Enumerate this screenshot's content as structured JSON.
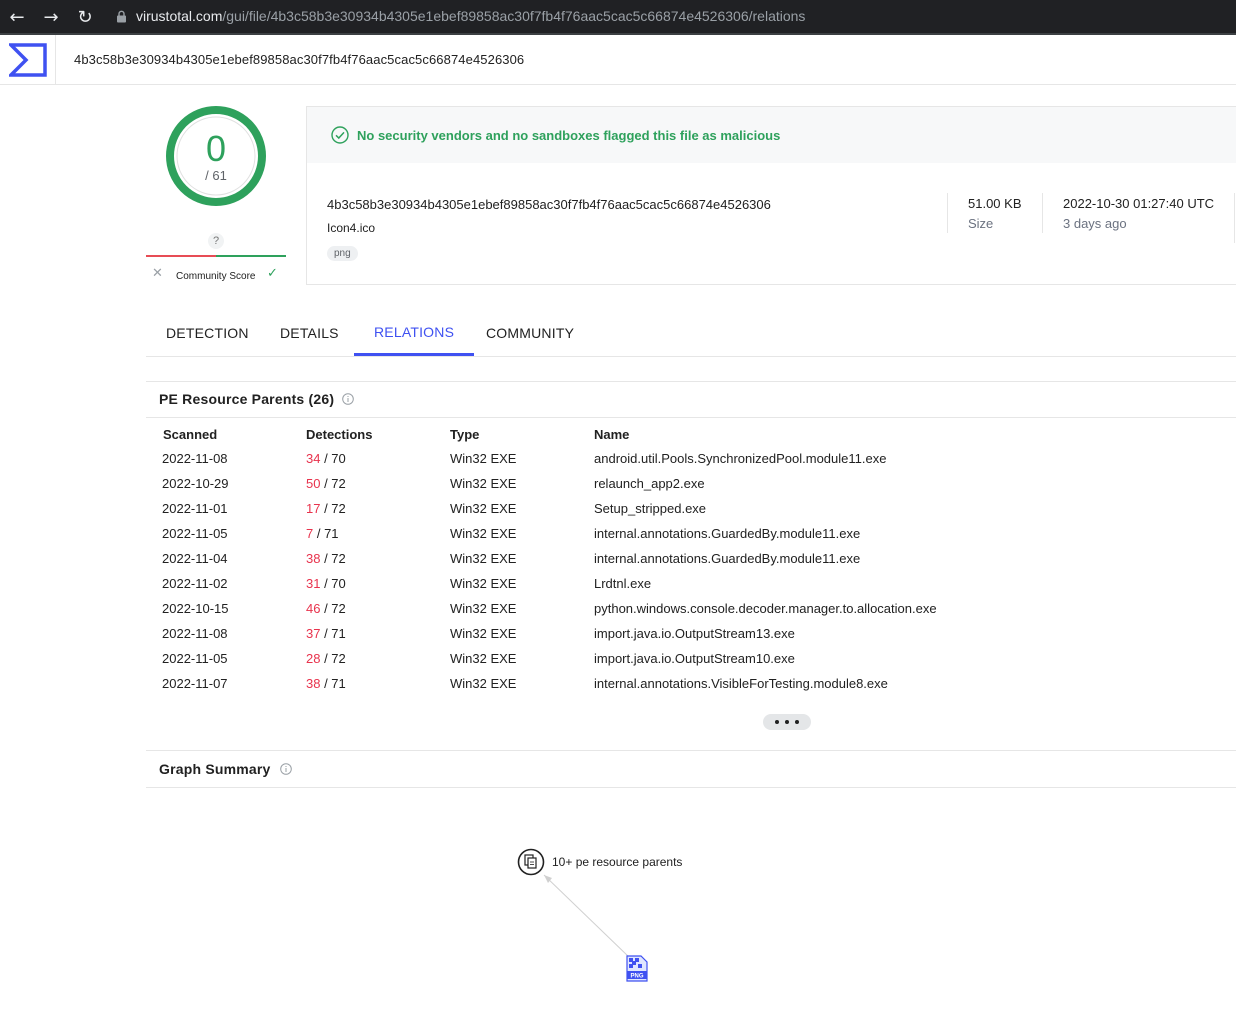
{
  "browser": {
    "url_host": "virustotal.com",
    "url_path": "/gui/file/4b3c58b3e30934b4305e1ebef89858ac30f7fb4f76aac5cac5c66874e4526306/relations",
    "back_icon": "arrow-left-icon",
    "forward_icon": "arrow-right-icon",
    "reload_icon": "reload-icon",
    "lock_icon": "lock-icon"
  },
  "header": {
    "logo": "virustotal-logo",
    "hash": "4b3c58b3e30934b4305e1ebef89858ac30f7fb4f76aac5cac5c66874e4526306"
  },
  "score": {
    "detections": "0",
    "total": "/ 61",
    "community_unknown": "?",
    "community_label": "Community Score",
    "ring_color": "#2ea15c"
  },
  "summary": {
    "banner": "No security vendors and no sandboxes flagged this file as malicious",
    "hash": "4b3c58b3e30934b4305e1ebef89858ac30f7fb4f76aac5cac5c66874e4526306",
    "file_name": "Icon4.ico",
    "tag": "png",
    "size_value": "51.00 KB",
    "size_label": "Size",
    "date_value": "2022-10-30 01:27:40 UTC",
    "date_label": "3 days ago"
  },
  "tabs": [
    {
      "label": "DETECTION",
      "active": false
    },
    {
      "label": "DETAILS",
      "active": false
    },
    {
      "label": "RELATIONS",
      "active": true
    },
    {
      "label": "COMMUNITY",
      "active": false
    }
  ],
  "pe_section": {
    "title": "PE Resource Parents (26)",
    "columns": [
      "Scanned",
      "Detections",
      "Type",
      "Name"
    ],
    "rows": [
      {
        "scanned": "2022-11-08",
        "det": "34",
        "total": " / 70",
        "type": "Win32 EXE",
        "name": "android.util.Pools.SynchronizedPool.module11.exe"
      },
      {
        "scanned": "2022-10-29",
        "det": "50",
        "total": " / 72",
        "type": "Win32 EXE",
        "name": "relaunch_app2.exe"
      },
      {
        "scanned": "2022-11-01",
        "det": "17",
        "total": " / 72",
        "type": "Win32 EXE",
        "name": "Setup_stripped.exe"
      },
      {
        "scanned": "2022-11-05",
        "det": "7",
        "total": " / 71",
        "type": "Win32 EXE",
        "name": "internal.annotations.GuardedBy.module11.exe"
      },
      {
        "scanned": "2022-11-04",
        "det": "38",
        "total": " / 72",
        "type": "Win32 EXE",
        "name": "internal.annotations.GuardedBy.module11.exe"
      },
      {
        "scanned": "2022-11-02",
        "det": "31",
        "total": " / 70",
        "type": "Win32 EXE",
        "name": "Lrdtnl.exe"
      },
      {
        "scanned": "2022-10-15",
        "det": "46",
        "total": " / 72",
        "type": "Win32 EXE",
        "name": "python.windows.console.decoder.manager.to.allocation.exe"
      },
      {
        "scanned": "2022-11-08",
        "det": "37",
        "total": " / 71",
        "type": "Win32 EXE",
        "name": "import.java.io.OutputStream13.exe"
      },
      {
        "scanned": "2022-11-05",
        "det": "28",
        "total": " / 72",
        "type": "Win32 EXE",
        "name": "import.java.io.OutputStream10.exe"
      },
      {
        "scanned": "2022-11-07",
        "det": "38",
        "total": " / 71",
        "type": "Win32 EXE",
        "name": "internal.annotations.VisibleForTesting.module8.exe"
      }
    ]
  },
  "graph_section": {
    "title": "Graph Summary",
    "node_label": "10+ pe resource parents",
    "file_icon": "png-file-icon",
    "parents_icon": "documents-icon",
    "file_icon_text": "PNG"
  },
  "colors": {
    "accent": "#3f51f1",
    "clean": "#2ea15c",
    "malicious": "#e8334d"
  }
}
